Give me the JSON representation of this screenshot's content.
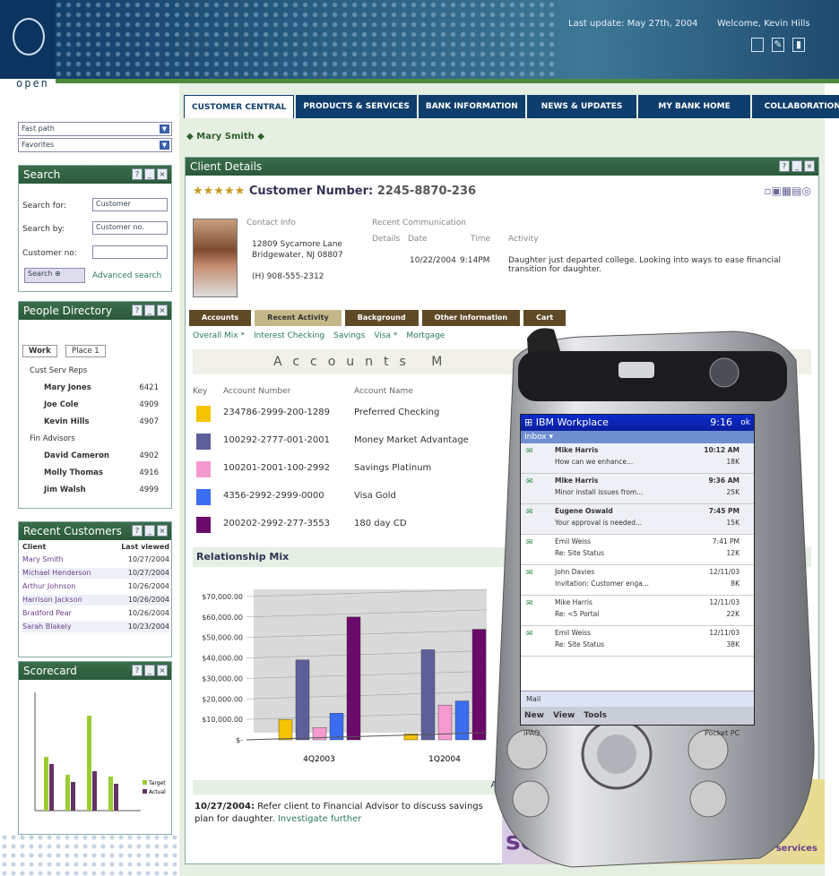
{
  "header": {
    "brand": "open",
    "last_update": "Last update: May 27th, 2004",
    "welcome": "Welcome, Kevin Hills"
  },
  "nav": {
    "tabs": [
      "CUSTOMER CENTRAL",
      "PRODUCTS & SERVICES",
      "BANK INFORMATION",
      "NEWS & UPDATES",
      "MY BANK HOME",
      "COLLABORATION"
    ],
    "breadcrumb": "Mary Smith"
  },
  "left": {
    "fast_path": "Fast path",
    "favorites": "Favorites",
    "search": {
      "title": "Search",
      "search_for_label": "Search for:",
      "search_for_value": "Customer",
      "search_by_label": "Search by:",
      "search_by_value": "Customer no.",
      "customer_no_label": "Customer no:",
      "search_button": "Search",
      "advanced": "Advanced search"
    },
    "people": {
      "title": "People Directory",
      "tab_work": "Work",
      "tab_place": "Place 1",
      "rows": [
        {
          "name": "Cust Serv Reps",
          "ext": ""
        },
        {
          "name": "Mary Jones",
          "ext": "6421"
        },
        {
          "name": "Joe Cole",
          "ext": "4909"
        },
        {
          "name": "Kevin Hills",
          "ext": "4907"
        },
        {
          "name": "Fin Advisors",
          "ext": ""
        },
        {
          "name": "David Cameron",
          "ext": "4902"
        },
        {
          "name": "Molly Thomas",
          "ext": "4916"
        },
        {
          "name": "Jim Walsh",
          "ext": "4999"
        }
      ]
    },
    "recent": {
      "title": "Recent Customers",
      "col_client": "Client",
      "col_last": "Last viewed",
      "rows": [
        {
          "name": "Mary Smith",
          "date": "10/27/2004"
        },
        {
          "name": "Michael Henderson",
          "date": "10/27/2004"
        },
        {
          "name": "Arthur Johnson",
          "date": "10/26/2004"
        },
        {
          "name": "Harrison Jackson",
          "date": "10/26/2004"
        },
        {
          "name": "Bradford Pear",
          "date": "10/26/2004"
        },
        {
          "name": "Sarah Blakely",
          "date": "10/23/2004"
        }
      ]
    },
    "scorecard": {
      "title": "Scorecard",
      "legend": [
        "Target",
        "Actual"
      ]
    }
  },
  "client": {
    "title": "Client Details",
    "stars": "★★★★★",
    "cust_label": "Customer Number:",
    "cust_no": "2245-8870-236",
    "contact_label": "Contact Info",
    "address1": "12809 Sycamore Lane",
    "address2": "Bridgewater, NJ 08807",
    "phone": "(H) 908-555-2312",
    "recent_label": "Recent Communication",
    "col_details": "Details",
    "col_date": "Date",
    "col_time": "Time",
    "col_activity": "Activity",
    "comm_date": "10/22/2004",
    "comm_time": "9:14PM",
    "comm_activity": "Daughter just departed college. Looking into ways to ease financial transition for daughter.",
    "subtabs": [
      "Accounts",
      "Recent Activity",
      "Background",
      "Other Information",
      "Cart"
    ],
    "itabs": [
      "Overall Mix *",
      "Interest Checking",
      "Savings",
      "Visa *",
      "Mortgage"
    ],
    "acc_head": "Accounts M",
    "col_key": "Key",
    "col_accnum": "Account Number",
    "col_accname": "Account Name",
    "accounts": [
      {
        "num": "234786-2999-200-1289",
        "name": "Preferred Checking",
        "color": "#f5c400"
      },
      {
        "num": "100292-2777-001-2001",
        "name": "Money Market Advantage",
        "color": "#5c5f9a"
      },
      {
        "num": "100201-2001-100-2992",
        "name": "Savings Platinum",
        "color": "#f59ad0"
      },
      {
        "num": "4356-2992-2999-0000",
        "name": "Visa Gold",
        "color": "#3a6df0"
      },
      {
        "num": "200202-2992-277-3553",
        "name": "180 day CD",
        "color": "#6a0a6a"
      }
    ],
    "rel_title": "Relationship Mix",
    "adv_head": "Ad",
    "adv_date": "10/27/2004:",
    "adv_text": "Refer client to Financial Advisor to discuss savings plan for daughter.",
    "adv_link": "Investigate further"
  },
  "chart_data": {
    "type": "bar",
    "categories": [
      "4Q2003",
      "1Q2004"
    ],
    "series": [
      {
        "name": "Preferred Checking",
        "values": [
          10000,
          3000
        ]
      },
      {
        "name": "Money Market Advantage",
        "values": [
          39000,
          44000
        ]
      },
      {
        "name": "Savings Platinum",
        "values": [
          6000,
          17000
        ]
      },
      {
        "name": "Visa Gold",
        "values": [
          13000,
          19000
        ]
      },
      {
        "name": "180 day CD",
        "values": [
          60000,
          54000
        ]
      }
    ],
    "yticks": [
      "$70,000.00",
      "$60,000.00",
      "$50,000.00",
      "$40,000.00",
      "$30,000.00",
      "$20,000.00",
      "$10,000.00",
      "$-"
    ],
    "ylim": [
      0,
      70000
    ]
  },
  "pda": {
    "brand_left": "iPAQ",
    "brand_right": "Pocket PC",
    "title": "IBM Workplace",
    "time": "9:16",
    "ok": "ok",
    "inbox": "Inbox",
    "mails": [
      {
        "from": "Mike Harris",
        "subj": "How can we enhance...",
        "time": "10:12 AM",
        "size": "18K"
      },
      {
        "from": "Mike Harris",
        "subj": "Minor install issues from...",
        "time": "9:36 AM",
        "size": "25K"
      },
      {
        "from": "Eugene Oswald",
        "subj": "Your approval is needed...",
        "time": "7:45 PM",
        "size": "15K"
      },
      {
        "from": "Emil Weiss",
        "subj": "Re: Site Status",
        "time": "7:41 PM",
        "size": "12K"
      },
      {
        "from": "John Davies",
        "subj": "Invitation: Customer enga...",
        "time": "12/11/03",
        "size": "8K"
      },
      {
        "from": "Mike Harris",
        "subj": "Re: <5 Portal",
        "time": "12/11/03",
        "size": "22K"
      },
      {
        "from": "Emil Weiss",
        "subj": "Re: Site Status",
        "time": "12/11/03",
        "size": "38K"
      }
    ],
    "bottom_tab": "Mail",
    "menu": [
      "New",
      "View",
      "Tools"
    ]
  },
  "banner": {
    "line1": "serious",
    "right1": "about",
    "right2": "products & services"
  }
}
